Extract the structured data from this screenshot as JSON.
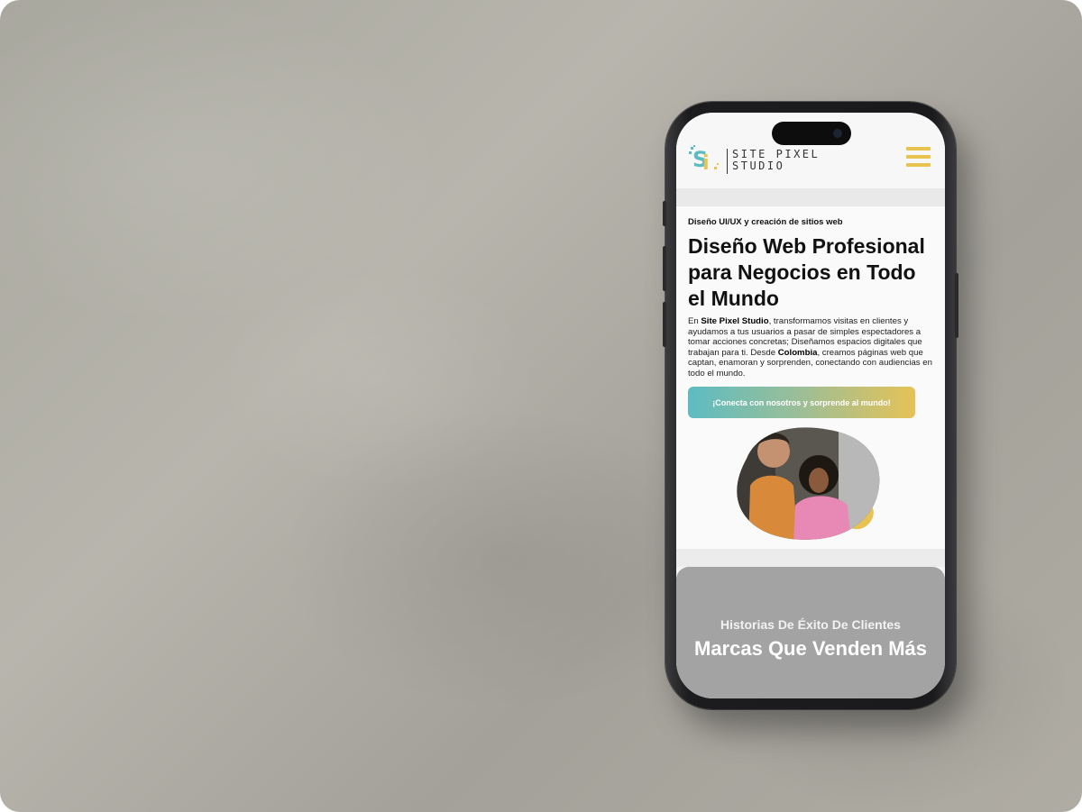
{
  "header": {
    "logo_line1": "SITE PIXEL",
    "logo_line2": "STUDIO",
    "menu_icon": "hamburger-menu-icon",
    "accent_color": "#e8c34f"
  },
  "hero": {
    "eyebrow": "Diseño UI/UX y creación de sitios web",
    "title": "Diseño Web Profesional para Negocios en Todo el Mundo",
    "paragraph": {
      "p1": "En ",
      "brand": "Site Pixel Studio",
      "p2": ", transformamos visitas en clientes y ayudamos a tus usuarios a pasar de simples espectadores a tomar acciones concretas; Diseñamos espacios digitales que trabajan para ti. Desde ",
      "country": "Colombia",
      "p3": ", creamos páginas web que captan, enamoran y sorprenden, conectando con audiencias en todo el mundo."
    },
    "cta_label": "¡Conecta con nosotros y sorprende al mundo!",
    "cta_gradient": [
      "#5dbcc2",
      "#e5c258"
    ]
  },
  "success_section": {
    "subtitle": "Historias De Éxito De Clientes",
    "title": "Marcas Que Venden Más"
  }
}
